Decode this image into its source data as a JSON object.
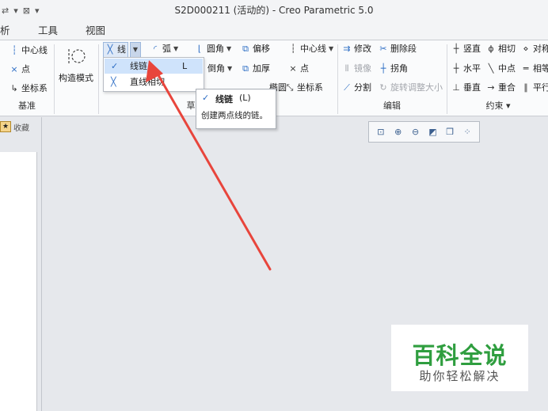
{
  "window": {
    "title": "S2D000211 (活动的) - Creo Parametric 5.0",
    "quick_access": [
      "⇄",
      "▾",
      "⊠",
      "▾"
    ]
  },
  "tabs": [
    {
      "label": "析"
    },
    {
      "label": "工具"
    },
    {
      "label": "视图"
    }
  ],
  "ribbon": {
    "datum": {
      "title": "基准",
      "items": [
        "中心线",
        "点",
        "坐标系"
      ]
    },
    "construction": {
      "label": "构造模式"
    },
    "sketch": {
      "line": "线",
      "arc": "弧",
      "fillet": "圆角",
      "chamfer": "倒角",
      "offset": "偏移",
      "thicken": "加厚",
      "ellipse_partial": "椭圆",
      "centerline": "中心线",
      "point": "点",
      "coordsys": "坐标系",
      "title_partial": "草"
    },
    "edit": {
      "title": "编辑",
      "items": [
        "修改",
        "删除段",
        "镜像",
        "拐角",
        "分割",
        "旋转调整大小"
      ]
    },
    "constrain": {
      "title": "约束 ▾",
      "items": [
        "竖直",
        "相切",
        "对称",
        "水平",
        "中点",
        "相等",
        "垂直",
        "重合",
        "平行"
      ]
    }
  },
  "dropdown": {
    "items": [
      {
        "label": "线链",
        "shortcut": "L"
      },
      {
        "label": "直线相切",
        "shortcut": ""
      }
    ]
  },
  "tooltip": {
    "title": "线链",
    "shortcut": "(L)",
    "description": "创建两点线的链。"
  },
  "left_panel": {
    "favorites": "收藏"
  },
  "view_toolbar": {
    "icons": [
      "refit-icon",
      "zoom-in-icon",
      "zoom-out-icon",
      "repaint-icon",
      "display-style-icon",
      "sketcher-display-icon"
    ]
  },
  "watermark": {
    "title": "百科全说",
    "subtitle": "助你轻松解决"
  },
  "colors": {
    "annotation_arrow": "#e8453c",
    "watermark_green": "#2f9e3f",
    "selection": "#cfe3fb",
    "icon_blue": "#2b6cc4"
  }
}
